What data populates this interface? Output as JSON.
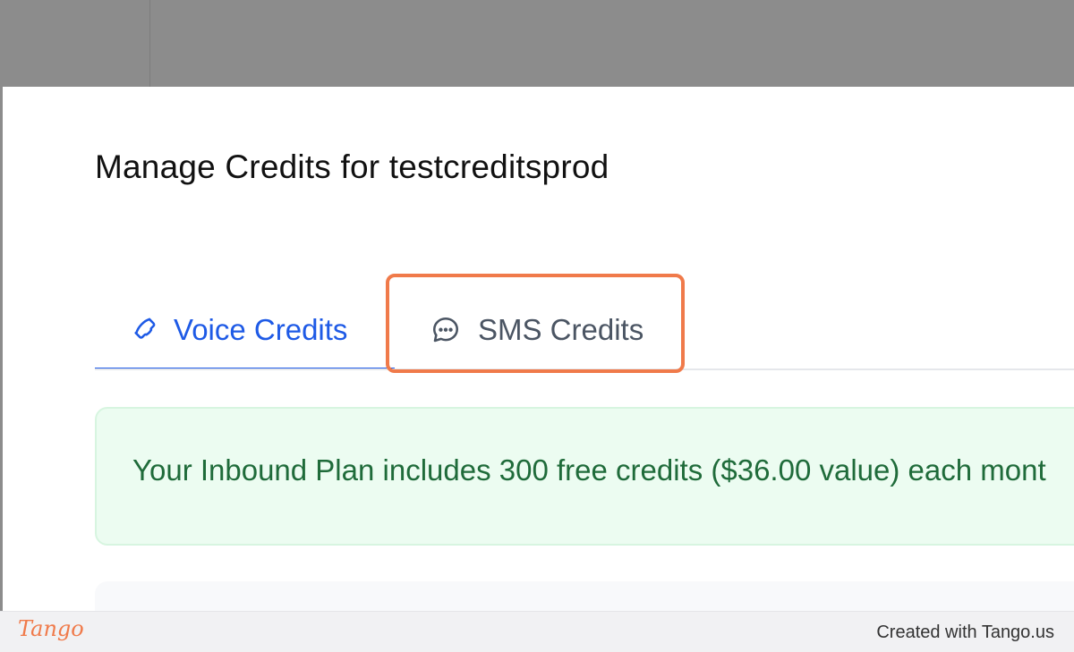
{
  "page": {
    "title": "Manage Credits for testcreditsprod"
  },
  "tabs": [
    {
      "label": "Voice Credits",
      "icon": "phone-icon",
      "active": true
    },
    {
      "label": "SMS Credits",
      "icon": "chat-bubble-icon",
      "active": false
    }
  ],
  "info_banner": {
    "text": "Your Inbound Plan includes 300 free credits ($36.00 value) each mont"
  },
  "footer": {
    "logo": "Tango",
    "credit": "Created with Tango.us"
  },
  "colors": {
    "accent": "#1e5ae6",
    "highlight": "#f07a4a",
    "banner_bg": "#ecfcf1",
    "banner_text": "#1f6b3a"
  }
}
